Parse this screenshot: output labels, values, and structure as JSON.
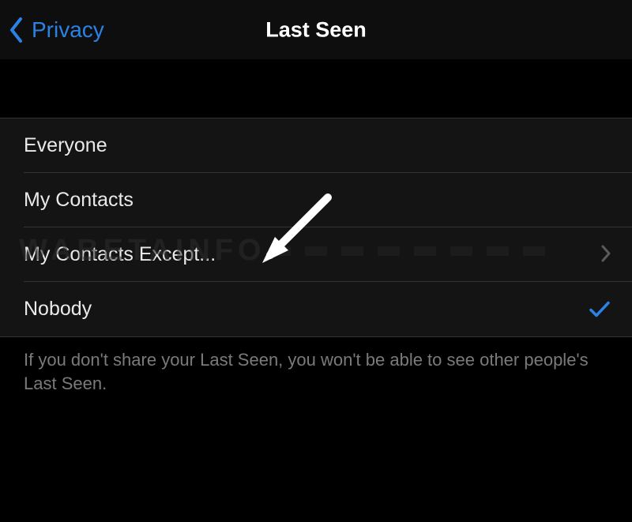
{
  "nav": {
    "back_label": "Privacy",
    "title": "Last Seen"
  },
  "options": [
    {
      "label": "Everyone",
      "hasDisclosure": false,
      "selected": false
    },
    {
      "label": "My Contacts",
      "hasDisclosure": false,
      "selected": false
    },
    {
      "label": "My Contacts Except...",
      "hasDisclosure": true,
      "selected": false
    },
    {
      "label": "Nobody",
      "hasDisclosure": false,
      "selected": true
    }
  ],
  "footer_text": "If you don't share your Last Seen, you won't be able to see other people's Last Seen.",
  "watermark": "WABETAINFO",
  "colors": {
    "accent": "#2b82e6",
    "bg_nav": "#0e0e0e",
    "bg_list": "#141414",
    "text_primary": "#eaeaea",
    "text_secondary": "#7a7a7a",
    "separator": "#333333"
  }
}
